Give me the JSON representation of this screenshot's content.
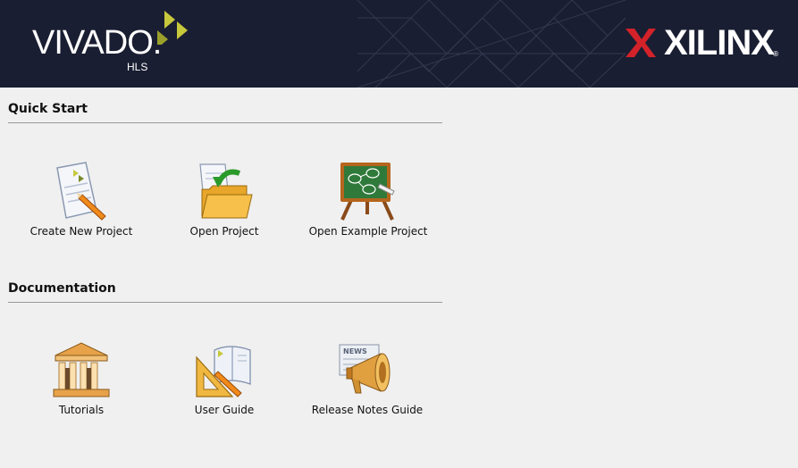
{
  "header": {
    "product_name": "VIVADO.",
    "product_sub": "HLS",
    "brand_name": "XILINX",
    "brand_reg": "®"
  },
  "quick_start": {
    "title": "Quick Start",
    "items": [
      {
        "label": "Create New Project",
        "icon": "create-project-icon"
      },
      {
        "label": "Open Project",
        "icon": "open-folder-icon"
      },
      {
        "label": "Open Example Project",
        "icon": "chalkboard-icon"
      }
    ]
  },
  "documentation": {
    "title": "Documentation",
    "items": [
      {
        "label": "Tutorials",
        "icon": "library-building-icon"
      },
      {
        "label": "User Guide",
        "icon": "guide-book-icon"
      },
      {
        "label": "Release Notes Guide",
        "icon": "news-megaphone-icon"
      }
    ]
  },
  "colors": {
    "banner_bg": "#1a1e32",
    "vivado_accent": "#c8c83c",
    "xilinx_red": "#d3222a",
    "page_bg": "#f0f0f0"
  }
}
